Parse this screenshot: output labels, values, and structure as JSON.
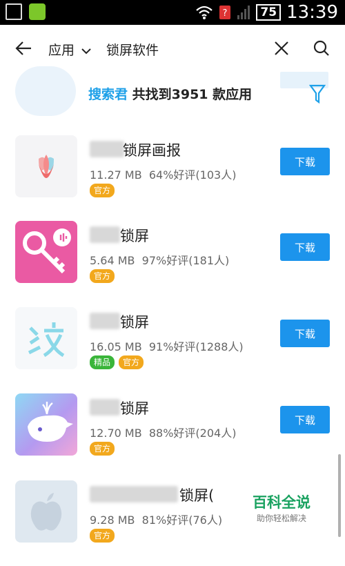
{
  "status_bar": {
    "battery": "75",
    "time": "13:39"
  },
  "search_bar": {
    "category": "应用",
    "query": "锁屏软件"
  },
  "summary": {
    "brand": "搜索君",
    "text": " 共找到3951 款应用"
  },
  "apps": [
    {
      "name_visible": "锁屏画报",
      "size": "11.27 MB",
      "rating": "64%好评(103人)",
      "tags": [
        "官方"
      ],
      "button": "下载"
    },
    {
      "name_visible": "锁屏",
      "size": "5.64 MB",
      "rating": "97%好评(181人)",
      "tags": [
        "官方"
      ],
      "button": "下载"
    },
    {
      "name_visible": "锁屏",
      "size": "16.05 MB",
      "rating": "91%好评(1288人)",
      "tags": [
        "精品",
        "官方"
      ],
      "button": "下载"
    },
    {
      "name_visible": "锁屏",
      "size": "12.70 MB",
      "rating": "88%好评(204人)",
      "tags": [
        "官方"
      ],
      "button": "下载"
    },
    {
      "name_visible": "锁屏(",
      "size": "9.28 MB",
      "rating": "81%好评(76人)",
      "tags": [
        "官方"
      ],
      "button": "下载"
    }
  ],
  "watermark": {
    "title": "百科全说",
    "subtitle": "助你轻松解决"
  },
  "colors": {
    "accent": "#1c94ec",
    "official_tag": "#f2a81d",
    "featured_tag": "#3ab53a"
  }
}
